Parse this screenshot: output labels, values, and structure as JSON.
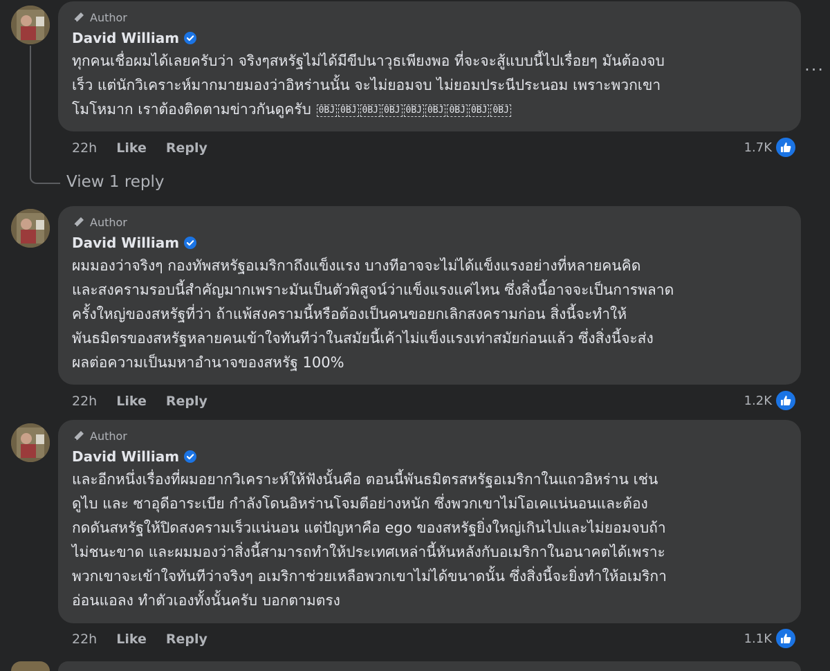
{
  "comments": [
    {
      "author_badge": "Author",
      "name": "David William",
      "text_lines": [
        "ทุกคนเชื่อผมได้เลยครับว่า จริงๆสหรัฐไม่ได้มีขีปนาวุธเพียงพอ ที่จะจะสู้แบบนี้ไปเรื่อยๆ มันต้องจบ",
        "เร็ว แต่นักวิเคราะห์มากมายมองว่าอิหร่านนั้น จะไม่ยอมจบ ไม่ยอมประนีประนอม เพราะพวกเขา",
        "โมโหมาก เราต้องติดตามข่าวกันดูครับ"
      ],
      "emoji_label": "0BJ",
      "time": "22h",
      "like": "Like",
      "reply": "Reply",
      "reaction_count": "1.7K"
    },
    {
      "author_badge": "Author",
      "name": "David William",
      "text_lines": [
        "ผมมองว่าจริงๆ กองทัพสหรัฐอเมริกาถึงแข็งแรง บางทีอาจจะไม่ได้แข็งแรงอย่างที่หลายคนคิด",
        "และสงครามรอบนี้สำคัญมากเพราะมันเป็นตัวพิสูจน์ว่าแข็งแรงแค่ไหน ซึ่งสิ่งนี้อาจจะเป็นการพลาด",
        "ครั้งใหญ่ของสหรัฐที่ว่า ถ้าแพ้สงครามนี้หรือต้องเป็นคนขอยกเลิกสงครามก่อน สิ่งนี้จะทำให้",
        "พันธมิตรของสหรัฐหลายคนเข้าใจทันทีว่าในสมัยนี้เค้าไม่แข็งแรงเท่าสมัยก่อนแล้ว ซึ่งสิ่งนี้จะส่ง",
        "ผลต่อความเป็นมหาอำนาจของสหรัฐ 100%"
      ],
      "time": "22h",
      "like": "Like",
      "reply": "Reply",
      "reaction_count": "1.2K"
    },
    {
      "author_badge": "Author",
      "name": "David William",
      "text_lines": [
        "และอีกหนึ่งเรื่องที่ผมอยากวิเคราะห์ให้ฟังนั้นคือ ตอนนี้พันธมิตรสหรัฐอเมริกาในแถวอิหร่าน เช่น",
        "ดูไบ และ ซาอุดีอาระเบีย กำลังโดนอิหร่านโจมตีอย่างหนัก ซึ่งพวกเขาไม่โอเคแน่นอนและต้อง",
        "กดดันสหรัฐให้ปิดสงครามเร็วแน่นอน แต่ปัญหาคือ ego ของสหรัฐยิ่งใหญ่เกินไปและไม่ยอมจบถ้า",
        "ไม่ชนะขาด และผมมองว่าสิ่งนี้สามารถทำให้ประเทศเหล่านี้หันหลังกับอเมริกาในอนาคตได้เพราะ",
        "พวกเขาจะเข้าใจทันทีว่าจริงๆ อเมริกาช่วยเหลือพวกเขาไม่ได้ขนาดนั้น ซึ่งสิ่งนี้จะยิ่งทำให้อเมริกา",
        "อ่อนแอลง ทำตัวเองทั้งนั้นครับ บอกตามตรง"
      ],
      "time": "22h",
      "like": "Like",
      "reply": "Reply",
      "reaction_count": "1.1K"
    }
  ],
  "view_reply_label": "View 1 reply",
  "more_label": "...",
  "colors": {
    "background": "#242526",
    "bubble": "#3a3b3c",
    "text": "#e4e6eb",
    "muted": "#b0b3b8",
    "accent": "#1b74e4"
  }
}
